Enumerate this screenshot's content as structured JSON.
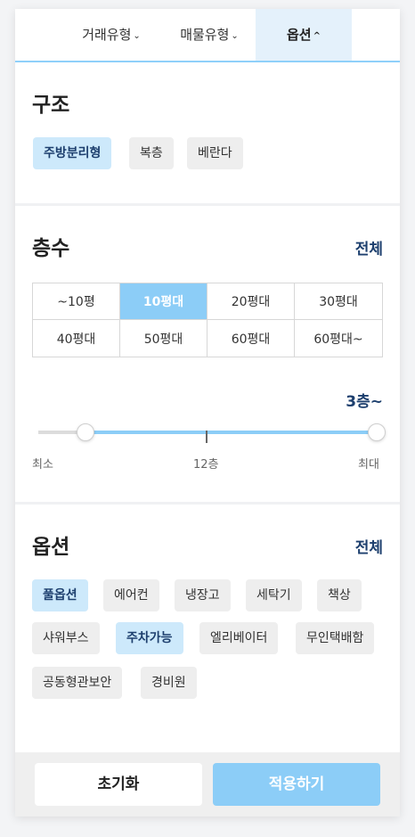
{
  "tabs": [
    {
      "label": "거래유형",
      "chevron": "⌄"
    },
    {
      "label": "매물유형",
      "chevron": "⌄"
    },
    {
      "label": "옵션",
      "chevron": "^"
    }
  ],
  "structure": {
    "title": "구조",
    "chips": [
      {
        "label": "주방분리형",
        "selected": true
      },
      {
        "label": "복층",
        "selected": false
      },
      {
        "label": "베란다",
        "selected": false
      }
    ]
  },
  "floors": {
    "title": "층수",
    "all_label": "전체",
    "sizes": [
      "~10평",
      "10평대",
      "20평대",
      "30평대",
      "40평대",
      "50평대",
      "60평대",
      "60평대~"
    ],
    "selected_size": "10평대",
    "range_value": "3층~",
    "slider": {
      "min_label": "최소",
      "mid_label": "12층",
      "max_label": "최대",
      "low_fraction": 0.14,
      "high_fraction": 1.0
    }
  },
  "options": {
    "title": "옵션",
    "all_label": "전체",
    "chips": [
      {
        "label": "풀옵션",
        "selected": true
      },
      {
        "label": "에어컨",
        "selected": false
      },
      {
        "label": "냉장고",
        "selected": false
      },
      {
        "label": "세탁기",
        "selected": false
      },
      {
        "label": "책상",
        "selected": false
      },
      {
        "label": "샤워부스",
        "selected": false
      },
      {
        "label": "주차가능",
        "selected": true
      },
      {
        "label": "엘리베이터",
        "selected": false
      },
      {
        "label": "무인택배함",
        "selected": false
      },
      {
        "label": "공동형관보안",
        "selected": false
      },
      {
        "label": "경비원",
        "selected": false
      }
    ]
  },
  "footer": {
    "reset_label": "초기화",
    "apply_label": "적용하기"
  },
  "colors": {
    "accent": "#8ccdf7",
    "accent_light": "#cde9fb",
    "navy": "#1d3f6e"
  }
}
